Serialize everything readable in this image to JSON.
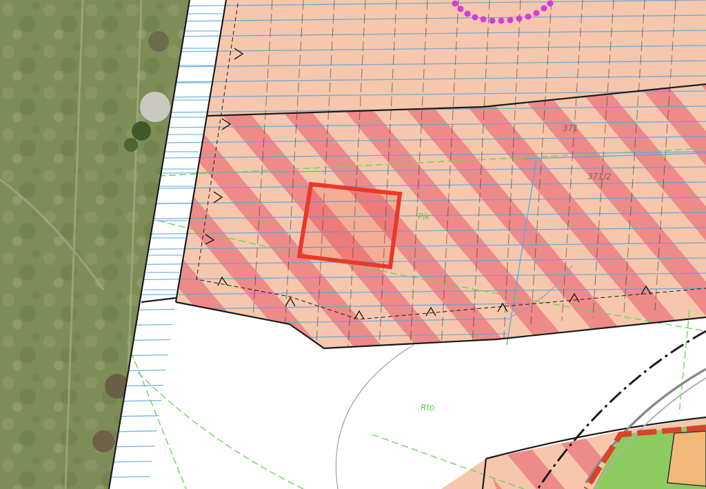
{
  "map": {
    "labels": {
      "parcel_371": "371",
      "parcel_371_2": "371/2",
      "zone_upper": "Pik",
      "zone_lower": "Rto"
    },
    "colors": {
      "aerial_base": "#7d8c55",
      "zone_fill": "#f6c7ad",
      "hatch_stripe": "#ef8a8a",
      "blue_hatch": "#5aa6e0",
      "highlight_red": "#e8392a",
      "magenta_dots": "#d63ad8",
      "green_lines": "#6ad45a",
      "green_area": "#8ccb5e",
      "orange_area": "#f0b978",
      "boundary_dark": "#1a1a1a"
    },
    "icons": {
      "boundary_markers": "triangle-tick-icon",
      "railway": "dash-dot-line-icon"
    }
  }
}
